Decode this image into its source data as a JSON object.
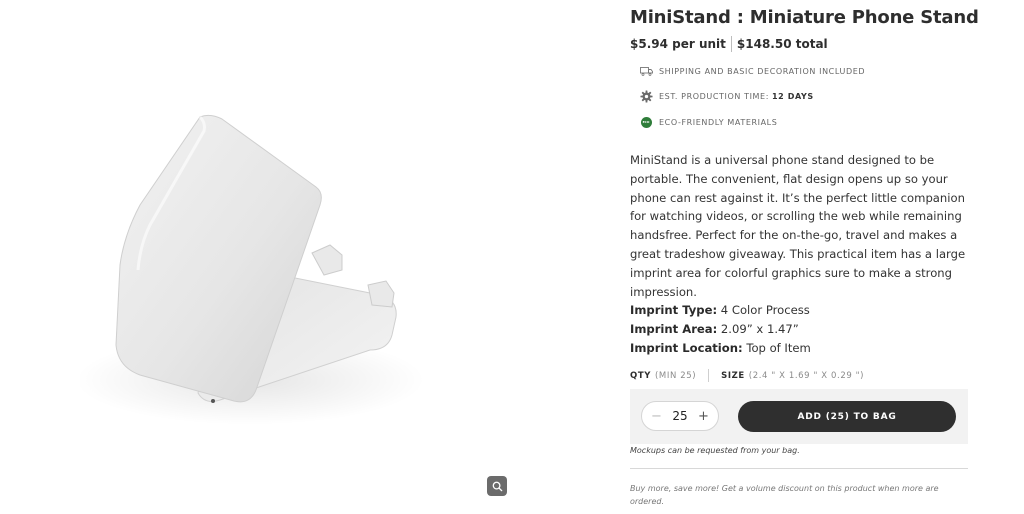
{
  "product": {
    "title": "MiniStand : Miniature Phone Stand",
    "unit_price": "$5.94 per unit",
    "total_price": "$148.50 total",
    "image_alt": "White MiniStand phone stand"
  },
  "features": [
    {
      "icon": "truck-icon",
      "text": "SHIPPING AND BASIC DECORATION INCLUDED",
      "value": ""
    },
    {
      "icon": "gear-icon",
      "text": "EST. PRODUCTION TIME:",
      "value": "12 DAYS"
    },
    {
      "icon": "eco-badge-icon",
      "badge": "ECO",
      "text": "ECO-FRIENDLY MATERIALS",
      "value": ""
    }
  ],
  "description": "MiniStand is a universal phone stand designed to be portable.  The convenient, flat design opens up so your phone can rest against it.  It’s the perfect little companion for watching videos, or scrolling the web while remaining handsfree.  Perfect for the on-the-go, travel and makes a great tradeshow giveaway.  This practical item has a large imprint area for colorful graphics sure to make a strong impression.",
  "specs": [
    {
      "label": "Imprint Type:",
      "value": "4 Color Process"
    },
    {
      "label": "Imprint Area:",
      "value": "2.09” x 1.47”"
    },
    {
      "label": "Imprint Location:",
      "value": "Top of Item"
    }
  ],
  "order": {
    "qty_label": "QTY",
    "qty_min": "(MIN 25)",
    "size_label": "SIZE",
    "size_value": "(2.4 \" X 1.69 \" X 0.29 \")",
    "quantity": "25",
    "minus_symbol": "−",
    "plus_symbol": "+",
    "add_button": "ADD (25) TO BAG"
  },
  "notes": {
    "mockup": "Mockups can be requested from your bag.",
    "bulk": "Buy more, save more! Get a volume discount on this product when more are ordered."
  }
}
